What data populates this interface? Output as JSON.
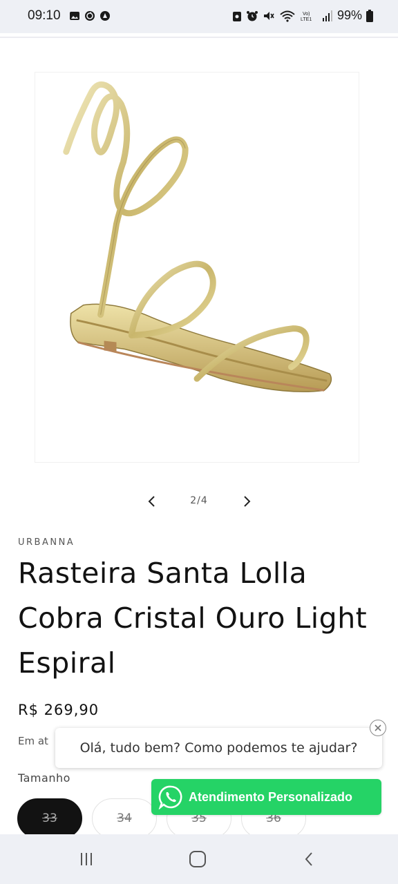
{
  "status_bar": {
    "time": "09:10",
    "battery": "99%",
    "left_icons": [
      "gallery-icon",
      "sync-icon",
      "app-icon"
    ],
    "right_icons": [
      "lock-icon",
      "alarm-icon",
      "mute-icon",
      "wifi-icon",
      "volte-icon",
      "signal-icon",
      "battery-icon"
    ]
  },
  "gallery": {
    "counter": "2/4",
    "prev_icon": "chevron-left-icon",
    "next_icon": "chevron-right-icon"
  },
  "product": {
    "vendor": "URBANNA",
    "title": "Rasteira Santa Lolla Cobra Cristal Ouro Light Espiral",
    "price": "R$ 269,90",
    "installments_visible": "Em at",
    "size_label": "Tamanho",
    "sizes": [
      {
        "label": "33",
        "selected": true,
        "unavailable": true
      },
      {
        "label": "34",
        "selected": false,
        "unavailable": true
      },
      {
        "label": "35",
        "selected": false,
        "unavailable": true
      },
      {
        "label": "36",
        "selected": false,
        "unavailable": true
      }
    ]
  },
  "chat": {
    "bubble_text": "Olá, tudo bem? Como podemos te ajudar?",
    "button_label": "Atendimento Personalizado",
    "button_color": "#25d366"
  },
  "nav_bar": {
    "buttons": [
      "recent-apps-icon",
      "home-icon",
      "back-icon"
    ]
  }
}
